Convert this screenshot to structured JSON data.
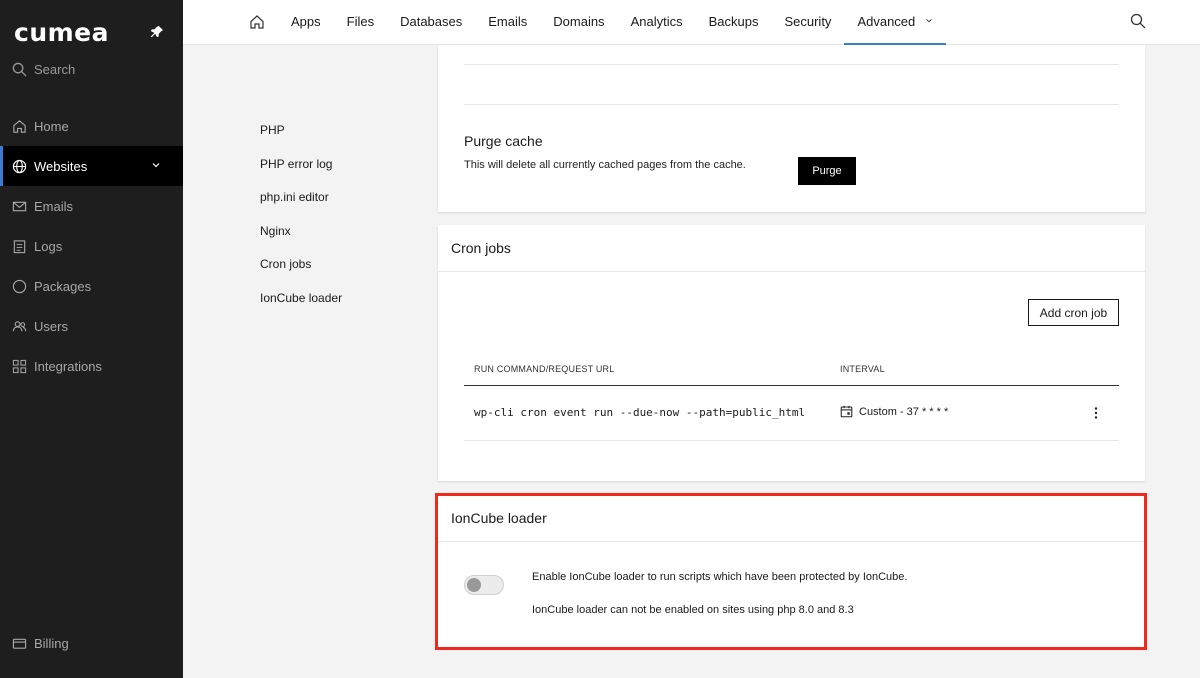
{
  "brand": {
    "logo_text": "cumea"
  },
  "sidebar": {
    "search_label": "Search",
    "items": [
      {
        "label": "Home",
        "icon": "home-icon"
      },
      {
        "label": "Websites",
        "icon": "globe-icon",
        "active": true
      },
      {
        "label": "Emails",
        "icon": "mail-icon"
      },
      {
        "label": "Logs",
        "icon": "logs-icon"
      },
      {
        "label": "Packages",
        "icon": "package-icon"
      },
      {
        "label": "Users",
        "icon": "users-icon"
      },
      {
        "label": "Integrations",
        "icon": "integrations-icon"
      }
    ],
    "billing_label": "Billing"
  },
  "topbar": {
    "tabs": [
      "Apps",
      "Files",
      "Databases",
      "Emails",
      "Domains",
      "Analytics",
      "Backups",
      "Security",
      "Advanced"
    ],
    "active_tab": "Advanced"
  },
  "subnav": {
    "items": [
      "PHP",
      "PHP error log",
      "php.ini editor",
      "Nginx",
      "Cron jobs",
      "IonCube loader"
    ]
  },
  "purge": {
    "title": "Purge cache",
    "description": "This will delete all currently cached pages from the cache.",
    "button": "Purge"
  },
  "cron": {
    "title": "Cron jobs",
    "add_button": "Add cron job",
    "columns": [
      "RUN COMMAND/REQUEST URL",
      "INTERVAL"
    ],
    "rows": [
      {
        "command": "wp-cli cron event run --due-now --path=public_html",
        "interval": "Custom - 37 * * * *"
      }
    ]
  },
  "ioncube": {
    "title": "IonCube loader",
    "enabled": false,
    "description": "Enable IonCube loader to run scripts which have been protected by IonCube.",
    "note": "IonCube loader can not be enabled on sites using php 8.0 and 8.3"
  },
  "colors": {
    "accent": "#3a7bd5",
    "highlight": "#f0281e",
    "sidebar_bg": "#1e1e1e"
  }
}
